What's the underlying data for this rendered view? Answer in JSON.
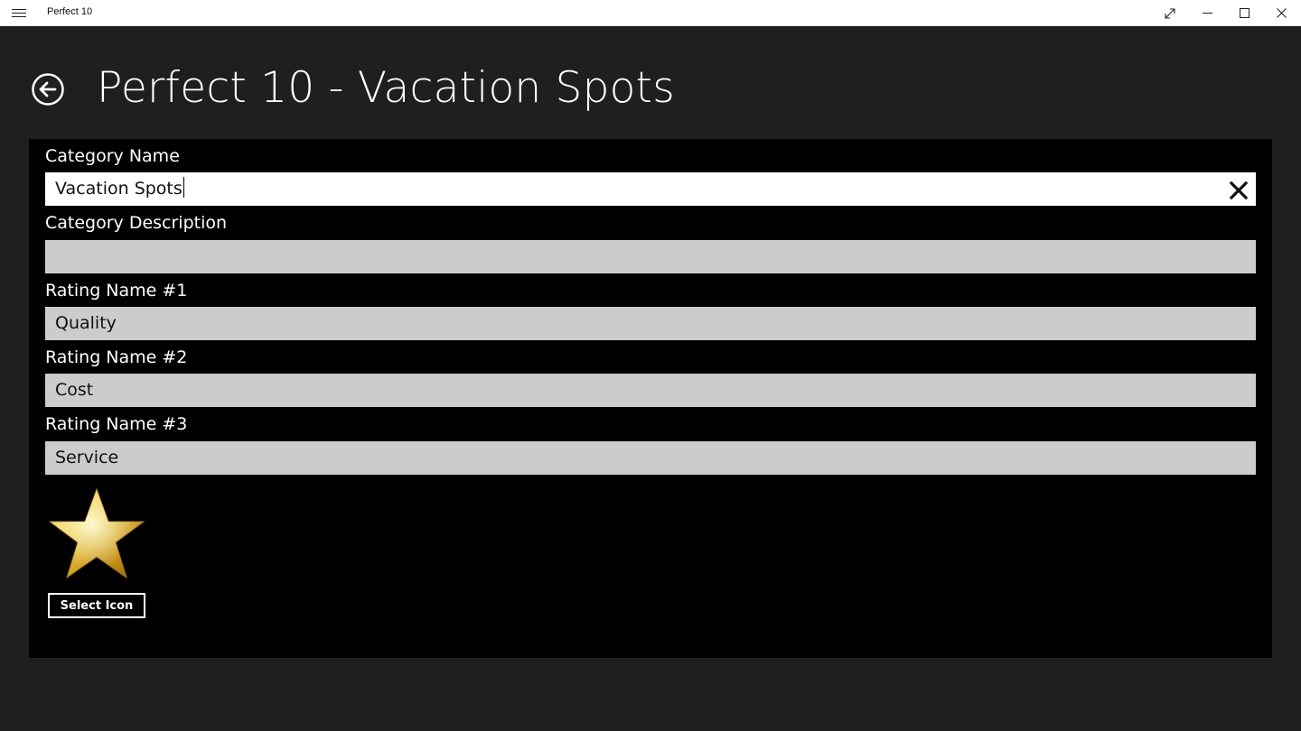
{
  "window": {
    "title": "Perfect 10",
    "menu_icon": "hamburger-icon",
    "controls": [
      "fullscreen-icon",
      "minimize-icon",
      "maximize-icon",
      "close-icon"
    ]
  },
  "header": {
    "back_icon": "back-arrow-icon",
    "title": "Perfect 10 - Vacation Spots"
  },
  "form": {
    "category_name": {
      "label": "Category Name",
      "value": "Vacation Spots"
    },
    "category_description": {
      "label": "Category Description",
      "value": ""
    },
    "rating1": {
      "label": "Rating Name #1",
      "value": "Quality"
    },
    "rating2": {
      "label": "Rating Name #2",
      "value": "Cost"
    },
    "rating3": {
      "label": "Rating Name #3",
      "value": "Service"
    },
    "icon": "star-icon",
    "select_icon_label": "Select Icon"
  },
  "colors": {
    "background": "#1f1f1f",
    "panel": "#000000",
    "input_bg": "#cccccc",
    "input_active_bg": "#ffffff",
    "star_gold": "#d4a017"
  }
}
